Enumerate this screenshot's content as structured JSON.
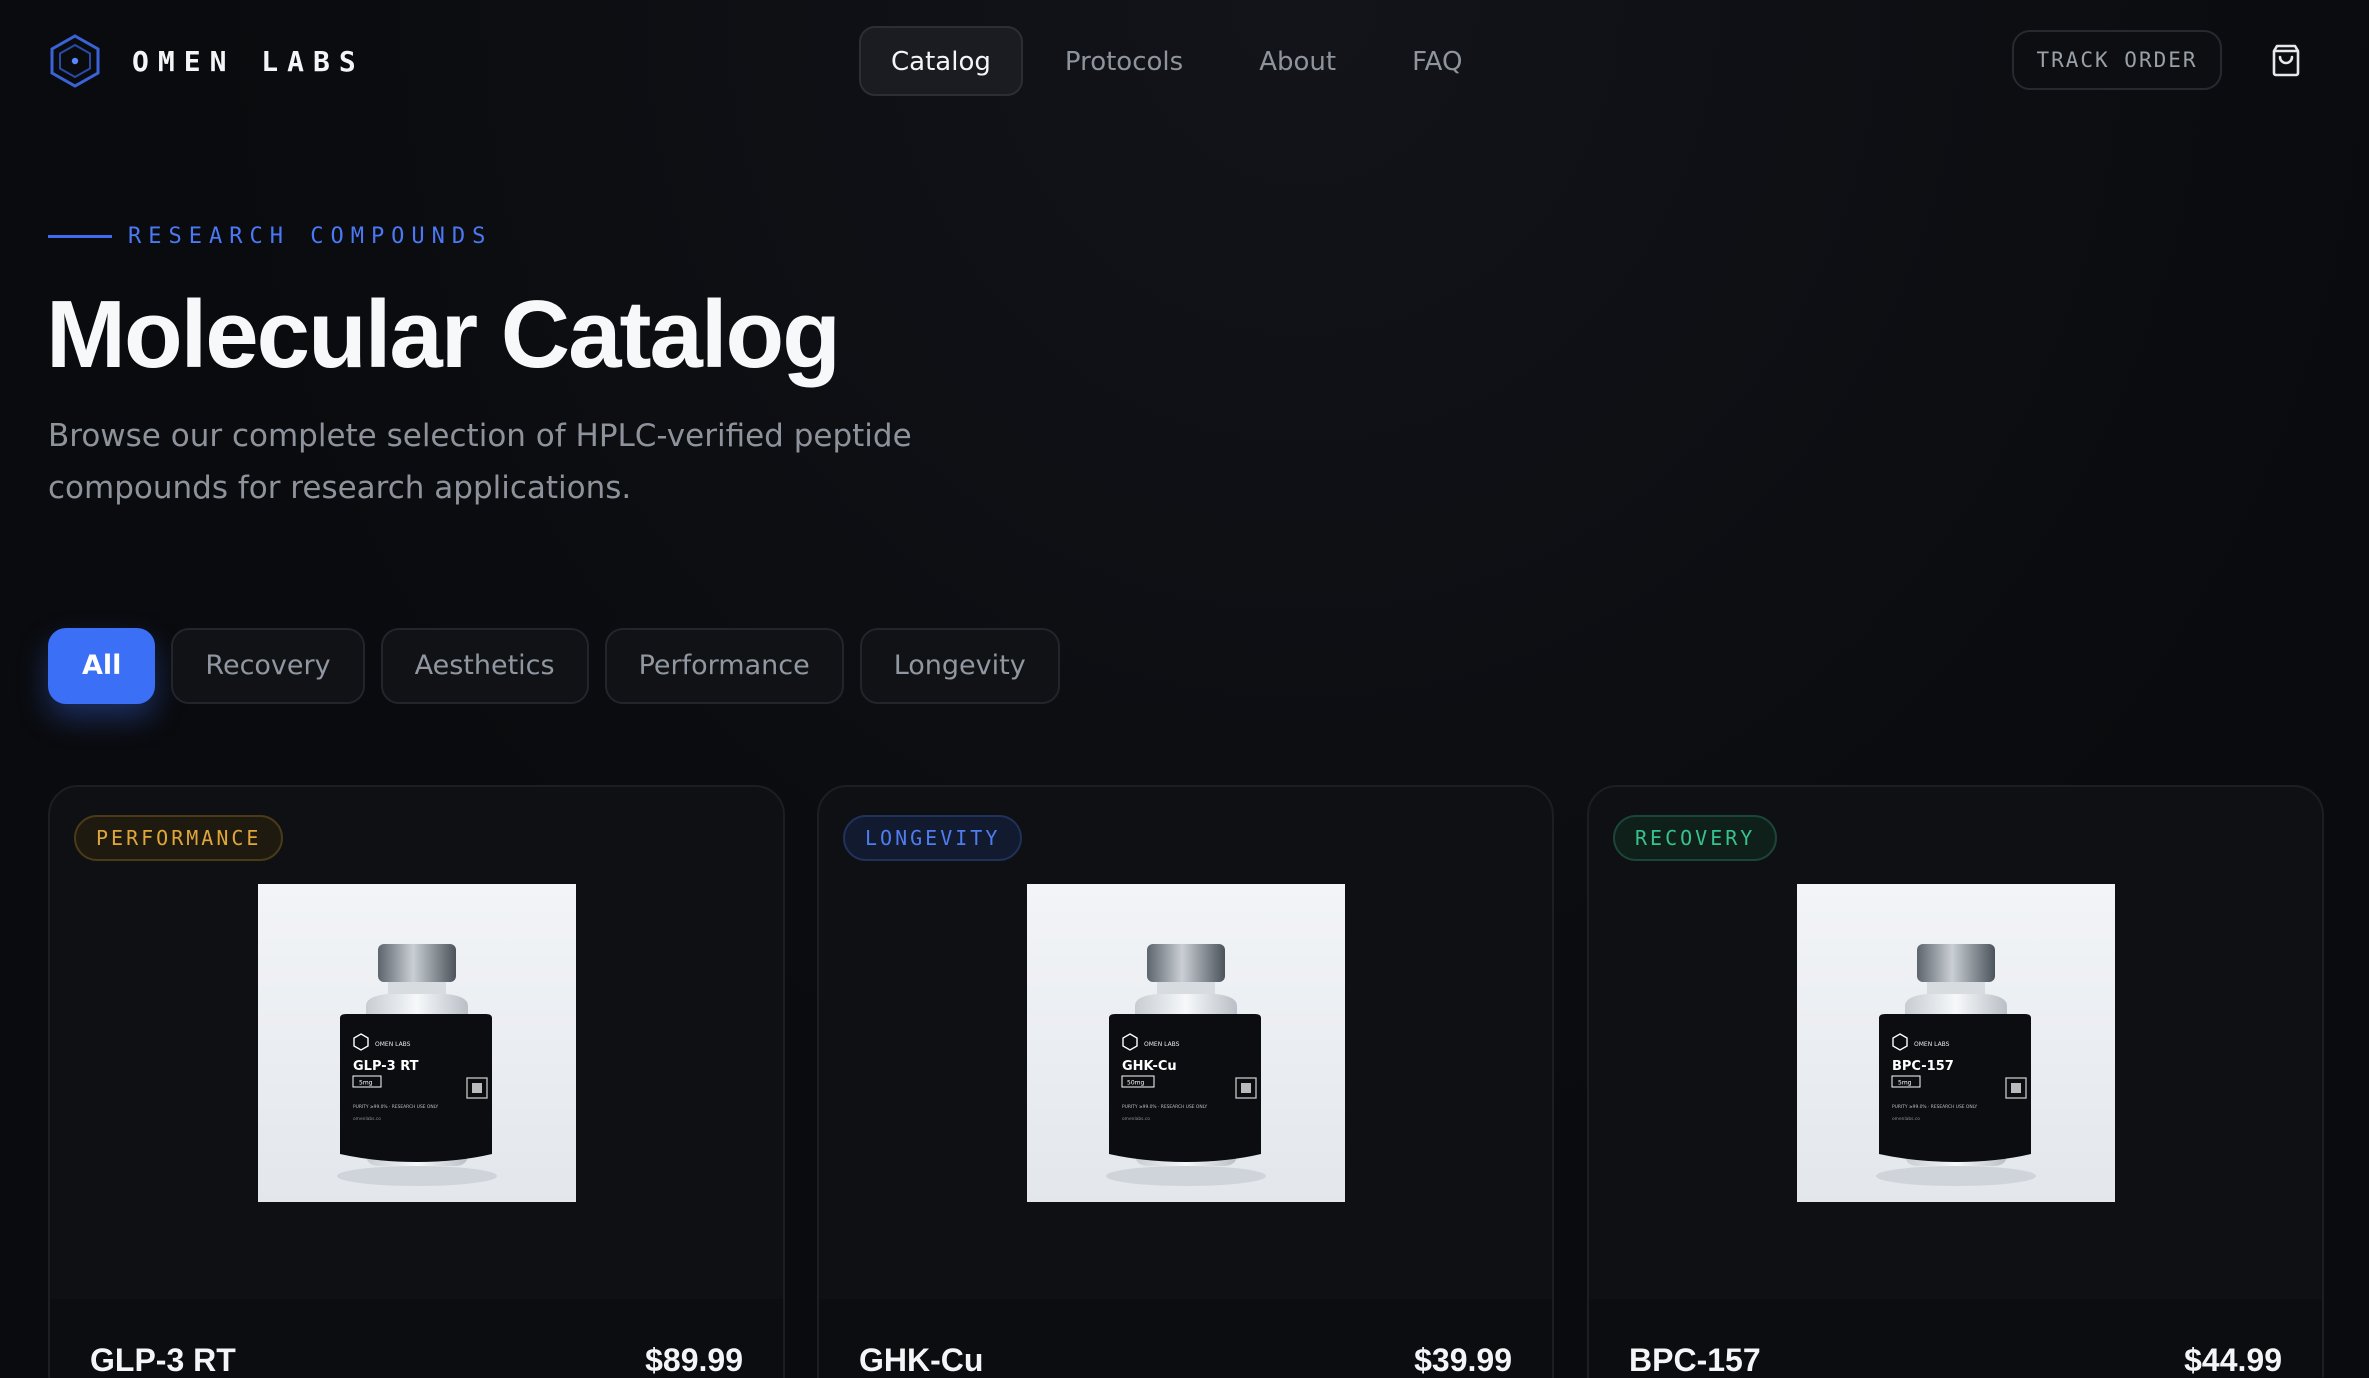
{
  "brand": {
    "name": "OMEN LABS",
    "logo_icon": "hexagon-logo-icon"
  },
  "nav": {
    "items": [
      {
        "label": "Catalog",
        "active": true
      },
      {
        "label": "Protocols",
        "active": false
      },
      {
        "label": "About",
        "active": false
      },
      {
        "label": "FAQ",
        "active": false
      }
    ],
    "track_order": "TRACK ORDER",
    "cart_icon": "shopping-bag-icon"
  },
  "hero": {
    "eyebrow": "RESEARCH COMPOUNDS",
    "title": "Molecular Catalog",
    "subtitle": "Browse our complete selection of HPLC-verified peptide compounds for research applications."
  },
  "filters": [
    {
      "label": "All",
      "active": true
    },
    {
      "label": "Recovery",
      "active": false
    },
    {
      "label": "Aesthetics",
      "active": false
    },
    {
      "label": "Performance",
      "active": false
    },
    {
      "label": "Longevity",
      "active": false
    }
  ],
  "products": [
    {
      "category": "PERFORMANCE",
      "name": "GLP-3 RT",
      "price": "$89.99",
      "label": {
        "brand": "OMEN LABS",
        "name": "GLP-3 RT",
        "dose": "5mg",
        "footer": "PURITY ≥99.0% · RESEARCH USE ONLY",
        "site": "omenlabs.co"
      }
    },
    {
      "category": "LONGEVITY",
      "name": "GHK-Cu",
      "price": "$39.99",
      "label": {
        "brand": "OMEN LABS",
        "name": "GHK-Cu",
        "dose": "50mg",
        "footer": "PURITY ≥99.0% · RESEARCH USE ONLY",
        "site": "omenlabs.co"
      }
    },
    {
      "category": "RECOVERY",
      "name": "BPC-157",
      "price": "$44.99",
      "label": {
        "brand": "OMEN LABS",
        "name": "BPC-157",
        "dose": "5mg",
        "footer": "PURITY ≥99.0% · RESEARCH USE ONLY",
        "site": "omenlabs.co"
      }
    }
  ],
  "colors": {
    "accent": "#3b6ff6",
    "performance": "#e0a63a",
    "longevity": "#4f7df0",
    "recovery": "#36c28e"
  }
}
